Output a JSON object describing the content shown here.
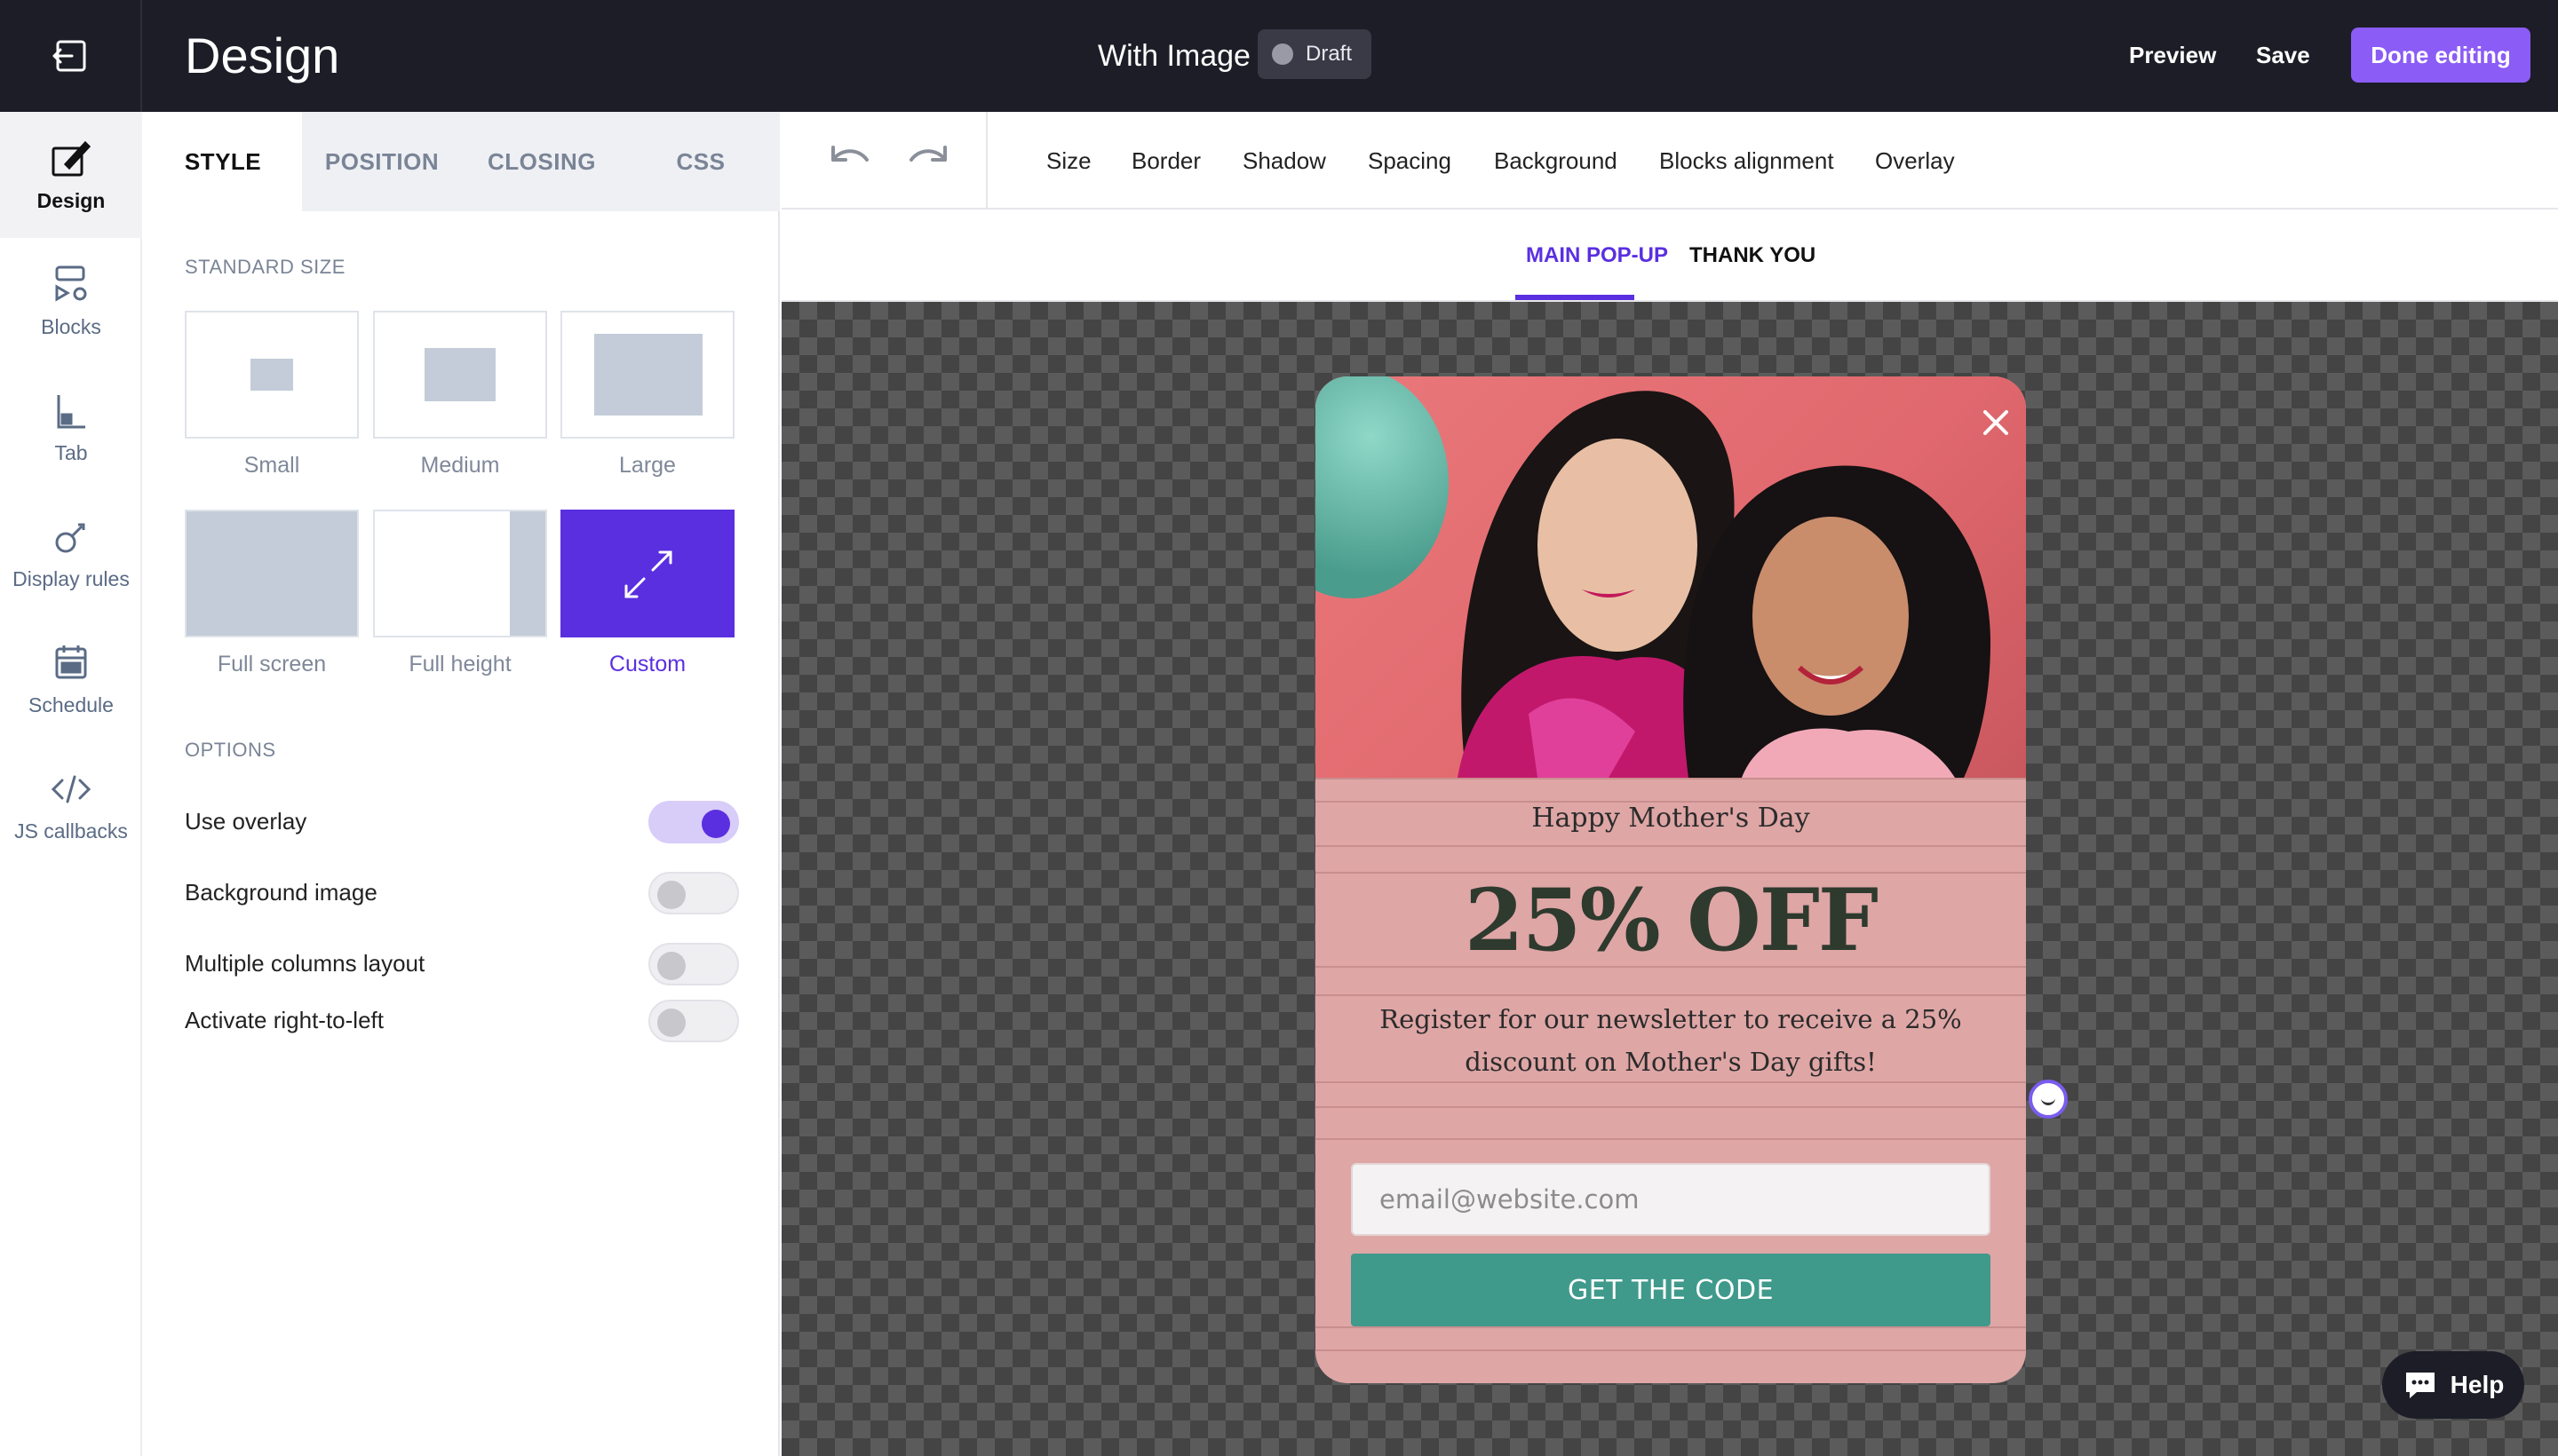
{
  "header": {
    "title": "Design",
    "campaign_name": "With Image",
    "status": "Draft",
    "preview_label": "Preview",
    "save_label": "Save",
    "done_label": "Done editing"
  },
  "leftnav": {
    "items": [
      {
        "label": "Design",
        "icon": "brush-icon",
        "active": true
      },
      {
        "label": "Blocks",
        "icon": "blocks-icon",
        "active": false
      },
      {
        "label": "Tab",
        "icon": "tab-icon",
        "active": false
      },
      {
        "label": "Display rules",
        "icon": "display-rules-icon",
        "active": false
      },
      {
        "label": "Schedule",
        "icon": "calendar-icon",
        "active": false
      },
      {
        "label": "JS callbacks",
        "icon": "code-icon",
        "active": false
      }
    ]
  },
  "panel": {
    "tabs": [
      "STYLE",
      "POSITION",
      "CLOSING",
      "CSS"
    ],
    "active_tab": "STYLE",
    "standard_size_title": "STANDARD SIZE",
    "sizes": [
      "Small",
      "Medium",
      "Large",
      "Full screen",
      "Full height",
      "Custom"
    ],
    "selected_size": "Custom",
    "options_title": "OPTIONS",
    "options": [
      {
        "label": "Use overlay",
        "on": true
      },
      {
        "label": "Background image",
        "on": false
      },
      {
        "label": "Multiple columns layout",
        "on": false
      },
      {
        "label": "Activate right-to-left",
        "on": false
      }
    ]
  },
  "toolbar": {
    "items": [
      "Size",
      "Border",
      "Shadow",
      "Spacing",
      "Background",
      "Blocks alignment",
      "Overlay"
    ]
  },
  "subtabs": {
    "items": [
      "MAIN POP-UP",
      "THANK YOU"
    ],
    "active": "MAIN POP-UP"
  },
  "popup": {
    "subtitle": "Happy Mother's Day",
    "headline": "25% OFF",
    "body": "Register for our newsletter to receive a 25% discount on Mother's Day gifts!",
    "email_placeholder": "email@website.com",
    "cta_label": "GET THE CODE"
  },
  "help_label": "Help",
  "colors": {
    "accent": "#5a2fe0",
    "done_button": "#8b5cf6",
    "popup_background": "#dfa6a6",
    "cta": "#3f9a8c",
    "topbar": "#1d1d27"
  }
}
